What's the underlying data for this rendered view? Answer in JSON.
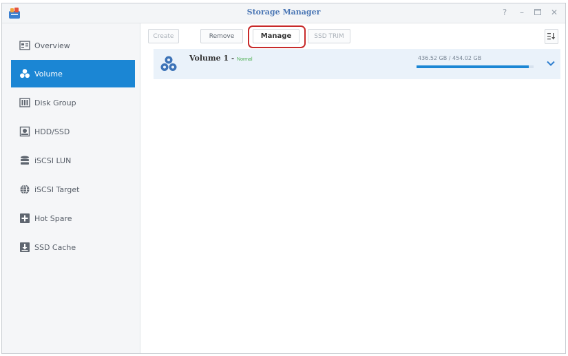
{
  "window": {
    "title": "Storage Manager"
  },
  "sidebar": {
    "items": [
      {
        "label": "Overview",
        "icon": "overview-icon"
      },
      {
        "label": "Volume",
        "icon": "volume-icon",
        "active": true
      },
      {
        "label": "Disk Group",
        "icon": "disk-group-icon"
      },
      {
        "label": "HDD/SSD",
        "icon": "hdd-icon"
      },
      {
        "label": "iSCSI LUN",
        "icon": "database-icon"
      },
      {
        "label": "iSCSI Target",
        "icon": "globe-icon"
      },
      {
        "label": "Hot Spare",
        "icon": "plus-icon"
      },
      {
        "label": "SSD Cache",
        "icon": "download-icon"
      }
    ]
  },
  "toolbar": {
    "create": "Create",
    "remove": "Remove",
    "manage": "Manage",
    "ssd_trim": "SSD TRIM",
    "view_icon": "list-sort-icon"
  },
  "volumes": [
    {
      "name": "Volume 1",
      "separator": "-",
      "status": "Normal",
      "usage": "436.52 GB / 454.02 GB",
      "used_fraction": 0.96
    }
  ],
  "colors": {
    "accent": "#1b86d4",
    "highlight": "#c82a2a",
    "status_normal": "#4caf50",
    "title": "#4a76b4"
  }
}
